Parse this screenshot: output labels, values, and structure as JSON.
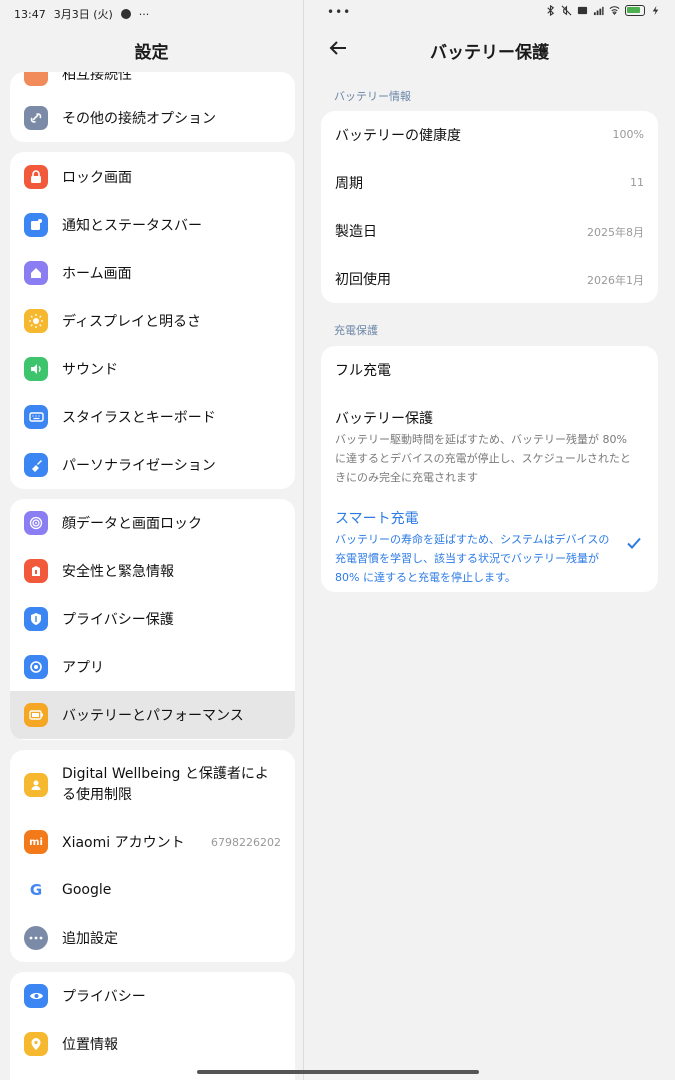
{
  "status_bar": {
    "time": "13:47",
    "date": "3月3日 (火)",
    "dots_left": "···",
    "dots_center": "•••",
    "battery_level": 0.65,
    "battery_color": "#4caf50"
  },
  "left": {
    "title": "設定",
    "group0": [
      {
        "label": "相互接続性",
        "icon": "link-icon",
        "color": "#f28b5a"
      },
      {
        "label": "その他の接続オプション",
        "icon": "connection-icon",
        "color": "#7b8aa6"
      }
    ],
    "group1": [
      {
        "label": "ロック画面",
        "icon": "lock-icon",
        "color": "#f2593b"
      },
      {
        "label": "通知とステータスバー",
        "icon": "notification-icon",
        "color": "#3b86f2"
      },
      {
        "label": "ホーム画面",
        "icon": "home-icon",
        "color": "#8b7ef2"
      },
      {
        "label": "ディスプレイと明るさ",
        "icon": "sun-icon",
        "color": "#f5b82e"
      },
      {
        "label": "サウンド",
        "icon": "speaker-icon",
        "color": "#3ec46d"
      },
      {
        "label": "スタイラスとキーボード",
        "icon": "keyboard-icon",
        "color": "#3b86f2"
      },
      {
        "label": "パーソナライゼーション",
        "icon": "brush-icon",
        "color": "#3b86f2"
      }
    ],
    "group2": [
      {
        "label": "顔データと画面ロック",
        "icon": "face-icon",
        "color": "#8b7ef2"
      },
      {
        "label": "安全性と緊急情報",
        "icon": "emergency-icon",
        "color": "#f2593b"
      },
      {
        "label": "プライバシー保護",
        "icon": "shield-icon",
        "color": "#3b86f2"
      },
      {
        "label": "アプリ",
        "icon": "apps-icon",
        "color": "#3b86f2"
      },
      {
        "label": "バッテリーとパフォーマンス",
        "icon": "battery-icon",
        "color": "#f5a623"
      }
    ],
    "group3": [
      {
        "label": "Digital Wellbeing と保護者による使用制限",
        "icon": "wellbeing-icon",
        "color": "#f5b82e"
      },
      {
        "label": "Xiaomi アカウント",
        "value": "6798226202",
        "icon": "mi-icon",
        "color": "#f27a1a"
      },
      {
        "label": "Google",
        "icon": "google-icon",
        "color": "#ffffff"
      },
      {
        "label": "追加設定",
        "icon": "more-icon",
        "color": "#7b8aa6"
      }
    ],
    "group4": [
      {
        "label": "プライバシー",
        "icon": "eye-icon",
        "color": "#3b86f2"
      },
      {
        "label": "位置情報",
        "icon": "location-icon",
        "color": "#f5b82e"
      }
    ],
    "icon_glyphs": {
      "mi": "mi",
      "google": "G"
    }
  },
  "right": {
    "title": "バッテリー保護",
    "section_info": "バッテリー情報",
    "info": [
      {
        "key": "バッテリーの健康度",
        "value": "100%"
      },
      {
        "key": "周期",
        "value": "11"
      },
      {
        "key": "製造日",
        "value": "2025年8月"
      },
      {
        "key": "初回使用",
        "value": "2026年1月"
      }
    ],
    "section_charge": "充電保護",
    "options": {
      "full": {
        "title": "フル充電"
      },
      "protect": {
        "title": "バッテリー保護",
        "desc": "バッテリー駆動時間を延ばすため、バッテリー残量が 80% に達するとデバイスの充電が停止し、スケジュールされたときにのみ完全に充電されます"
      },
      "smart": {
        "title": "スマート充電",
        "desc": "バッテリーの寿命を延ばすため、システムはデバイスの充電習慣を学習し、該当する状況でバッテリー残量が 80% に達すると充電を停止します。",
        "selected": true
      }
    },
    "accent": "#2c7be5"
  }
}
